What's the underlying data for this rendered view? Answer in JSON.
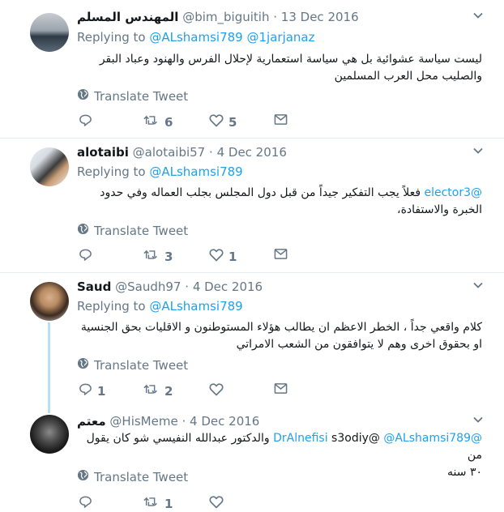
{
  "tweets": [
    {
      "name": "المهندس المسلم",
      "handle": "@bim_biguitih",
      "date": "13 Dec 2016",
      "replying_label": "Replying to",
      "replying_to": [
        "@ALshamsi789",
        "@1jarjanaz"
      ],
      "text_prefix_mention": "",
      "text": "ليست سياسة عشوائية بل هي سياسة استعمارية لإحلال الفرس والهنود وعباد البقر والصليب محل العرب المسلمين",
      "translate": "Translate Tweet",
      "replies": "",
      "retweets": "6",
      "likes": "5"
    },
    {
      "name": "alotaibi",
      "handle": "@alotaibi57",
      "date": "4 Dec 2016",
      "replying_label": "Replying to",
      "replying_to": [
        "@ALshamsi789"
      ],
      "text_prefix_mention": "@elector3",
      "text": "فعلاً يجب التفكير جيداً من قبل دول المجلس بجلب العماله وفي حدود الخبرة والاستفادة،",
      "translate": "Translate Tweet",
      "replies": "",
      "retweets": "3",
      "likes": "1"
    },
    {
      "name": "Saud",
      "handle": "@Saudh97",
      "date": "4 Dec 2016",
      "replying_label": "Replying to",
      "replying_to": [
        "@ALshamsi789"
      ],
      "text_prefix_mention": "",
      "text": "كلام واقعي جداً ، الخطر الاعظم ان يطالب هؤلاء المستوطنون و الاقليات بحق الجنسية او بحقوق اخرى وهم لا يتوافقون من الشعب الامراتي",
      "translate": "Translate Tweet",
      "replies": "1",
      "retweets": "2",
      "likes": ""
    },
    {
      "name": "معتم",
      "handle": "@HisMeme",
      "date": "4 Dec 2016",
      "replying_label": "",
      "replying_to": [],
      "text_prefix_mention": "",
      "text_line1_mentions": [
        "@DrAlnefisi",
        "s3odiy@",
        "@ALshamsi789"
      ],
      "text_line1_tail": "والدكتور عبدالله النفيسي شو كان يقول من",
      "text_line2": "٣٠ سنه",
      "translate": "Translate Tweet",
      "replies": "",
      "retweets": "1",
      "likes": ""
    }
  ],
  "dot": "·",
  "icons": [
    "globe-icon",
    "reply-icon",
    "retweet-icon",
    "like-icon",
    "message-icon",
    "chevron-down-icon"
  ],
  "colors": {
    "accent": "#1da1f2",
    "muted": "#657786",
    "thread": "#b8e0f5"
  }
}
